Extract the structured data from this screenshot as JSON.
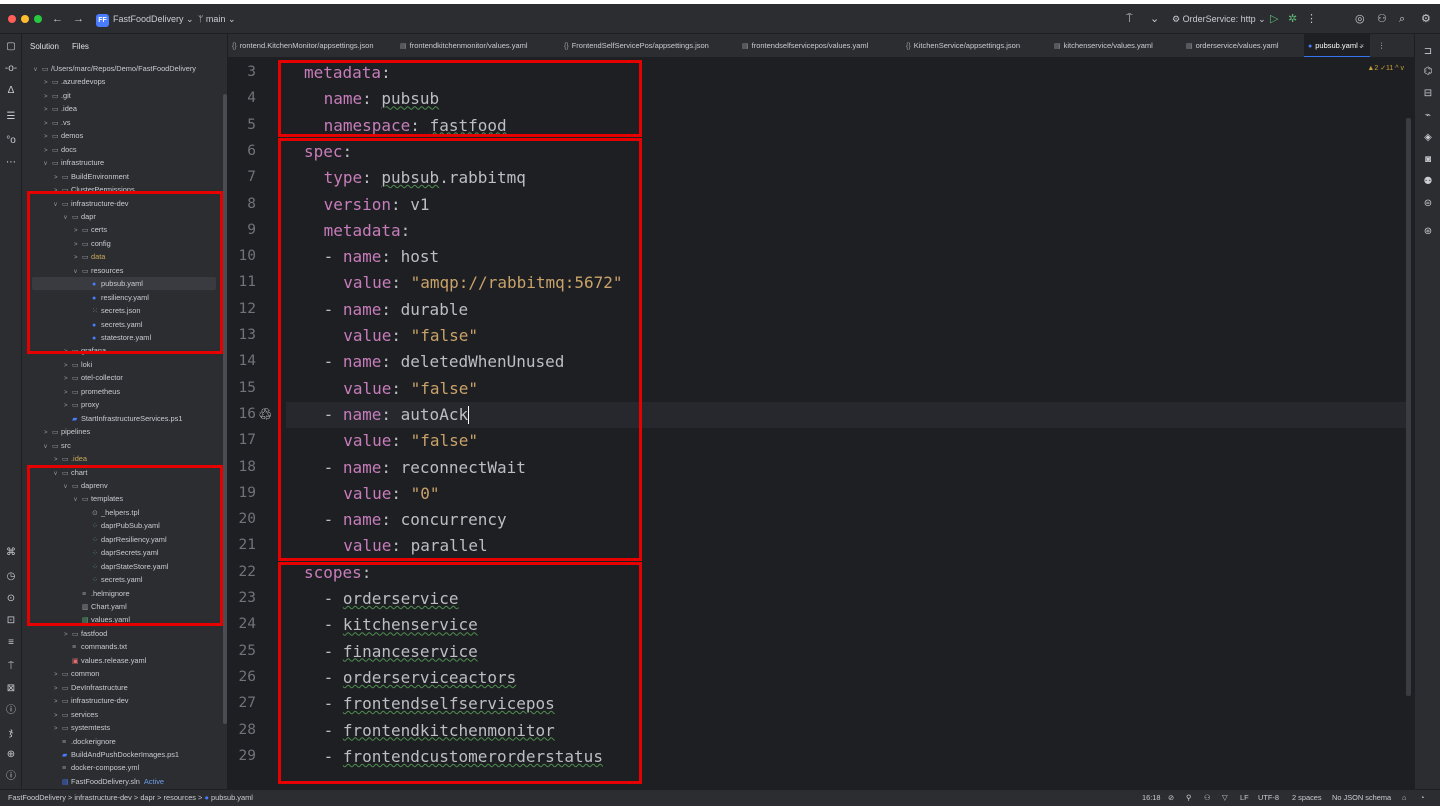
{
  "titlebar": {
    "project": "FastFoodDelivery",
    "project_badge": "FF",
    "branch": "main",
    "run_config": "OrderService: http"
  },
  "left_strip_icons": [
    "folder-icon",
    "commit-icon",
    "git-icon",
    "structure-icon",
    "bookmarks-icon",
    "more-icon",
    "plugins-icon",
    "run-icon",
    "debug-icon",
    "services-icon",
    "todo-icon",
    "terminal-icon",
    "problems-icon",
    "version-control-icon",
    "notifications-icon"
  ],
  "project_panel": {
    "tabs": [
      "Solution",
      "Files"
    ],
    "tree": [
      {
        "indent": 0,
        "arrow": "v",
        "icon": "dir",
        "text": "/Users/marc/Repos/Demo/FastFoodDelivery"
      },
      {
        "indent": 1,
        "arrow": ">",
        "icon": "dir",
        "text": ".azuredevops"
      },
      {
        "indent": 1,
        "arrow": ">",
        "icon": "dir",
        "text": ".git"
      },
      {
        "indent": 1,
        "arrow": ">",
        "icon": "dir",
        "text": ".idea"
      },
      {
        "indent": 1,
        "arrow": ">",
        "icon": "dir",
        "text": ".vs"
      },
      {
        "indent": 1,
        "arrow": ">",
        "icon": "dir",
        "text": "demos"
      },
      {
        "indent": 1,
        "arrow": ">",
        "icon": "dir",
        "text": "docs"
      },
      {
        "indent": 1,
        "arrow": "v",
        "icon": "dir",
        "text": "infrastructure"
      },
      {
        "indent": 2,
        "arrow": ">",
        "icon": "dir",
        "text": "BuildEnvironment"
      },
      {
        "indent": 2,
        "arrow": ">",
        "icon": "dir",
        "text": "ClusterPermissions"
      },
      {
        "indent": 2,
        "arrow": "v",
        "icon": "dir",
        "text": "infrastructure-dev"
      },
      {
        "indent": 3,
        "arrow": "v",
        "icon": "dir",
        "text": "dapr"
      },
      {
        "indent": 4,
        "arrow": ">",
        "icon": "dir",
        "text": "certs"
      },
      {
        "indent": 4,
        "arrow": ">",
        "icon": "dir",
        "text": "config"
      },
      {
        "indent": 4,
        "arrow": ">",
        "icon": "dir",
        "text": "data",
        "style": "dim"
      },
      {
        "indent": 4,
        "arrow": "v",
        "icon": "dir",
        "text": "resources"
      },
      {
        "indent": 5,
        "arrow": "",
        "icon": "yaml",
        "text": "pubsub.yaml",
        "selected": true
      },
      {
        "indent": 5,
        "arrow": "",
        "icon": "yaml",
        "text": "resiliency.yaml"
      },
      {
        "indent": 5,
        "arrow": "",
        "icon": "json",
        "text": "secrets.json"
      },
      {
        "indent": 5,
        "arrow": "",
        "icon": "yaml",
        "text": "secrets.yaml"
      },
      {
        "indent": 5,
        "arrow": "",
        "icon": "yaml",
        "text": "statestore.yaml"
      },
      {
        "indent": 3,
        "arrow": ">",
        "icon": "dir",
        "text": "grafana"
      },
      {
        "indent": 3,
        "arrow": ">",
        "icon": "dir",
        "text": "loki"
      },
      {
        "indent": 3,
        "arrow": ">",
        "icon": "dir",
        "text": "otel-collector"
      },
      {
        "indent": 3,
        "arrow": ">",
        "icon": "dir",
        "text": "prometheus"
      },
      {
        "indent": 3,
        "arrow": ">",
        "icon": "dir",
        "text": "proxy"
      },
      {
        "indent": 3,
        "arrow": "",
        "icon": "ps",
        "text": "StartInfrastructureServices.ps1"
      },
      {
        "indent": 1,
        "arrow": ">",
        "icon": "dir",
        "text": "pipelines"
      },
      {
        "indent": 1,
        "arrow": "v",
        "icon": "dir",
        "text": "src"
      },
      {
        "indent": 2,
        "arrow": ">",
        "icon": "dir",
        "text": ".idea",
        "style": "dim"
      },
      {
        "indent": 2,
        "arrow": "v",
        "icon": "dir",
        "text": "chart"
      },
      {
        "indent": 3,
        "arrow": "v",
        "icon": "dir",
        "text": "daprenv"
      },
      {
        "indent": 4,
        "arrow": "v",
        "icon": "dir",
        "text": "templates"
      },
      {
        "indent": 5,
        "arrow": "",
        "icon": "tpl",
        "text": "_helpers.tpl"
      },
      {
        "indent": 5,
        "arrow": "",
        "icon": "tplyaml",
        "text": "daprPubSub.yaml"
      },
      {
        "indent": 5,
        "arrow": "",
        "icon": "tplyaml",
        "text": "daprResiliency.yaml"
      },
      {
        "indent": 5,
        "arrow": "",
        "icon": "tplyaml",
        "text": "daprSecrets.yaml"
      },
      {
        "indent": 5,
        "arrow": "",
        "icon": "tplyaml",
        "text": "daprStateStore.yaml"
      },
      {
        "indent": 5,
        "arrow": "",
        "icon": "tplyaml",
        "text": "secrets.yaml"
      },
      {
        "indent": 4,
        "arrow": "",
        "icon": "txt",
        "text": ".helmignore"
      },
      {
        "indent": 4,
        "arrow": "",
        "icon": "chart",
        "text": "Chart.yaml"
      },
      {
        "indent": 4,
        "arrow": "",
        "icon": "vals",
        "text": "values.yaml"
      },
      {
        "indent": 3,
        "arrow": ">",
        "icon": "dir",
        "text": "fastfood"
      },
      {
        "indent": 3,
        "arrow": "",
        "icon": "txt",
        "text": "commands.txt"
      },
      {
        "indent": 3,
        "arrow": "",
        "icon": "red",
        "text": "values.release.yaml"
      },
      {
        "indent": 2,
        "arrow": ">",
        "icon": "dir",
        "text": "common"
      },
      {
        "indent": 2,
        "arrow": ">",
        "icon": "dir",
        "text": "DevInfrastructure"
      },
      {
        "indent": 2,
        "arrow": ">",
        "icon": "dir",
        "text": "infrastructure-dev"
      },
      {
        "indent": 2,
        "arrow": ">",
        "icon": "dir",
        "text": "services"
      },
      {
        "indent": 2,
        "arrow": ">",
        "icon": "dir",
        "text": "systemtests"
      },
      {
        "indent": 2,
        "arrow": "",
        "icon": "txt",
        "text": ".dockerignore"
      },
      {
        "indent": 2,
        "arrow": "",
        "icon": "ps",
        "text": "BuildAndPushDockerImages.ps1"
      },
      {
        "indent": 2,
        "arrow": "",
        "icon": "txt",
        "text": "docker-compose.yml"
      },
      {
        "indent": 2,
        "arrow": "",
        "icon": "sln",
        "text": "FastFoodDelivery.sln",
        "suffix": "Active"
      }
    ]
  },
  "tabs": [
    {
      "icon": "json",
      "label": "rontend.KitchenMonitor/appsettings.json"
    },
    {
      "icon": "vals",
      "label": "frontendkitchenmonitor/values.yaml"
    },
    {
      "icon": "json",
      "label": "FrontendSelfServicePos/appsettings.json"
    },
    {
      "icon": "vals",
      "label": "frontendselfservicepos/values.yaml"
    },
    {
      "icon": "json",
      "label": "KitchenService/appsettings.json"
    },
    {
      "icon": "vals",
      "label": "kitchenservice/values.yaml"
    },
    {
      "icon": "vals",
      "label": "orderservice/values.yaml"
    },
    {
      "icon": "yaml",
      "label": "pubsub.yaml",
      "active": true
    }
  ],
  "editor": {
    "inspection": "▲2 ✓11 ^ v",
    "lines": [
      {
        "n": "3",
        "indent": 0,
        "parts": [
          [
            "k",
            "metadata"
          ],
          [
            "plain",
            ":"
          ]
        ]
      },
      {
        "n": "4",
        "indent": 1,
        "parts": [
          [
            "k",
            "name"
          ],
          [
            "plain",
            ": "
          ],
          [
            "wavy",
            "pubsub"
          ]
        ]
      },
      {
        "n": "5",
        "indent": 1,
        "parts": [
          [
            "k",
            "namespace"
          ],
          [
            "plain",
            ": "
          ],
          [
            "wavy",
            "fastfood"
          ]
        ]
      },
      {
        "n": "6",
        "indent": 0,
        "parts": [
          [
            "k",
            "spec"
          ],
          [
            "plain",
            ":"
          ]
        ]
      },
      {
        "n": "7",
        "indent": 1,
        "parts": [
          [
            "k",
            "type"
          ],
          [
            "plain",
            ": "
          ],
          [
            "wavy",
            "pubsub"
          ],
          [
            "plain",
            ".rabbitmq"
          ]
        ]
      },
      {
        "n": "8",
        "indent": 1,
        "parts": [
          [
            "k",
            "version"
          ],
          [
            "plain",
            ": v1"
          ]
        ]
      },
      {
        "n": "9",
        "indent": 1,
        "parts": [
          [
            "k",
            "metadata"
          ],
          [
            "plain",
            ":"
          ]
        ]
      },
      {
        "n": "10",
        "indent": 1,
        "parts": [
          [
            "plain",
            "- "
          ],
          [
            "k",
            "name"
          ],
          [
            "plain",
            ": host"
          ]
        ]
      },
      {
        "n": "11",
        "indent": 2,
        "parts": [
          [
            "k",
            "value"
          ],
          [
            "plain",
            ": "
          ],
          [
            "sq",
            "\"amqp://rabbitmq:5672\""
          ]
        ]
      },
      {
        "n": "12",
        "indent": 1,
        "parts": [
          [
            "plain",
            "- "
          ],
          [
            "k",
            "name"
          ],
          [
            "plain",
            ": durable"
          ]
        ]
      },
      {
        "n": "13",
        "indent": 2,
        "parts": [
          [
            "k",
            "value"
          ],
          [
            "plain",
            ": "
          ],
          [
            "sq",
            "\"false\""
          ]
        ]
      },
      {
        "n": "14",
        "indent": 1,
        "parts": [
          [
            "plain",
            "- "
          ],
          [
            "k",
            "name"
          ],
          [
            "plain",
            ": deletedWhenUnused"
          ]
        ]
      },
      {
        "n": "15",
        "indent": 2,
        "parts": [
          [
            "k",
            "value"
          ],
          [
            "plain",
            ": "
          ],
          [
            "sq",
            "\"false\""
          ]
        ]
      },
      {
        "n": "16",
        "indent": 1,
        "parts": [
          [
            "plain",
            "- "
          ],
          [
            "k",
            "name"
          ],
          [
            "plain",
            ": autoAck"
          ],
          [
            "caret",
            ""
          ]
        ]
      },
      {
        "n": "17",
        "indent": 2,
        "parts": [
          [
            "k",
            "value"
          ],
          [
            "plain",
            ": "
          ],
          [
            "sq",
            "\"false\""
          ]
        ]
      },
      {
        "n": "18",
        "indent": 1,
        "parts": [
          [
            "plain",
            "- "
          ],
          [
            "k",
            "name"
          ],
          [
            "plain",
            ": reconnectWait"
          ]
        ]
      },
      {
        "n": "19",
        "indent": 2,
        "parts": [
          [
            "k",
            "value"
          ],
          [
            "plain",
            ": "
          ],
          [
            "sq",
            "\"0\""
          ]
        ]
      },
      {
        "n": "20",
        "indent": 1,
        "parts": [
          [
            "plain",
            "- "
          ],
          [
            "k",
            "name"
          ],
          [
            "plain",
            ": concurrency"
          ]
        ]
      },
      {
        "n": "21",
        "indent": 2,
        "parts": [
          [
            "k",
            "value"
          ],
          [
            "plain",
            ": parallel"
          ]
        ]
      },
      {
        "n": "22",
        "indent": 0,
        "parts": [
          [
            "k",
            "scopes"
          ],
          [
            "plain",
            ":"
          ]
        ]
      },
      {
        "n": "23",
        "indent": 1,
        "parts": [
          [
            "plain",
            "- "
          ],
          [
            "wavy",
            "orderservice"
          ]
        ]
      },
      {
        "n": "24",
        "indent": 1,
        "parts": [
          [
            "plain",
            "- "
          ],
          [
            "wavy",
            "kitchenservice"
          ]
        ]
      },
      {
        "n": "25",
        "indent": 1,
        "parts": [
          [
            "plain",
            "- "
          ],
          [
            "wavy",
            "financeservice"
          ]
        ]
      },
      {
        "n": "26",
        "indent": 1,
        "parts": [
          [
            "plain",
            "- "
          ],
          [
            "wavy",
            "orderserviceactors"
          ]
        ]
      },
      {
        "n": "27",
        "indent": 1,
        "parts": [
          [
            "plain",
            "- "
          ],
          [
            "wavy",
            "frontendselfservicepos"
          ]
        ]
      },
      {
        "n": "28",
        "indent": 1,
        "parts": [
          [
            "plain",
            "- "
          ],
          [
            "wavy",
            "frontendkitchenmonitor"
          ]
        ]
      },
      {
        "n": "29",
        "indent": 1,
        "parts": [
          [
            "plain",
            "- "
          ],
          [
            "wavy",
            "frontendcustomerorderstatus"
          ]
        ]
      }
    ]
  },
  "right_strip_icons": [
    "notifications-icon",
    "ai-assistant-icon",
    "database-icon",
    "endpoints-icon",
    "nuget-icon",
    "coverage-icon",
    "copilot-icon",
    "dpa-icon",
    "unit-tests-icon"
  ],
  "statusbar": {
    "breadcrumb": [
      "FastFoodDelivery",
      "infrastructure-dev",
      "dapr",
      "resources",
      "pubsub.yaml"
    ],
    "position": "16:18",
    "line_ending": "LF",
    "encoding": "UTF-8",
    "indent": "2 spaces",
    "schema": "No JSON schema"
  },
  "colors": {
    "background": "#1e1f22",
    "panel": "#2b2d30",
    "keyword": "#c77dbb",
    "string": "#c9a26a",
    "highlight_box": "#e60000",
    "accent": "#3574f0"
  }
}
